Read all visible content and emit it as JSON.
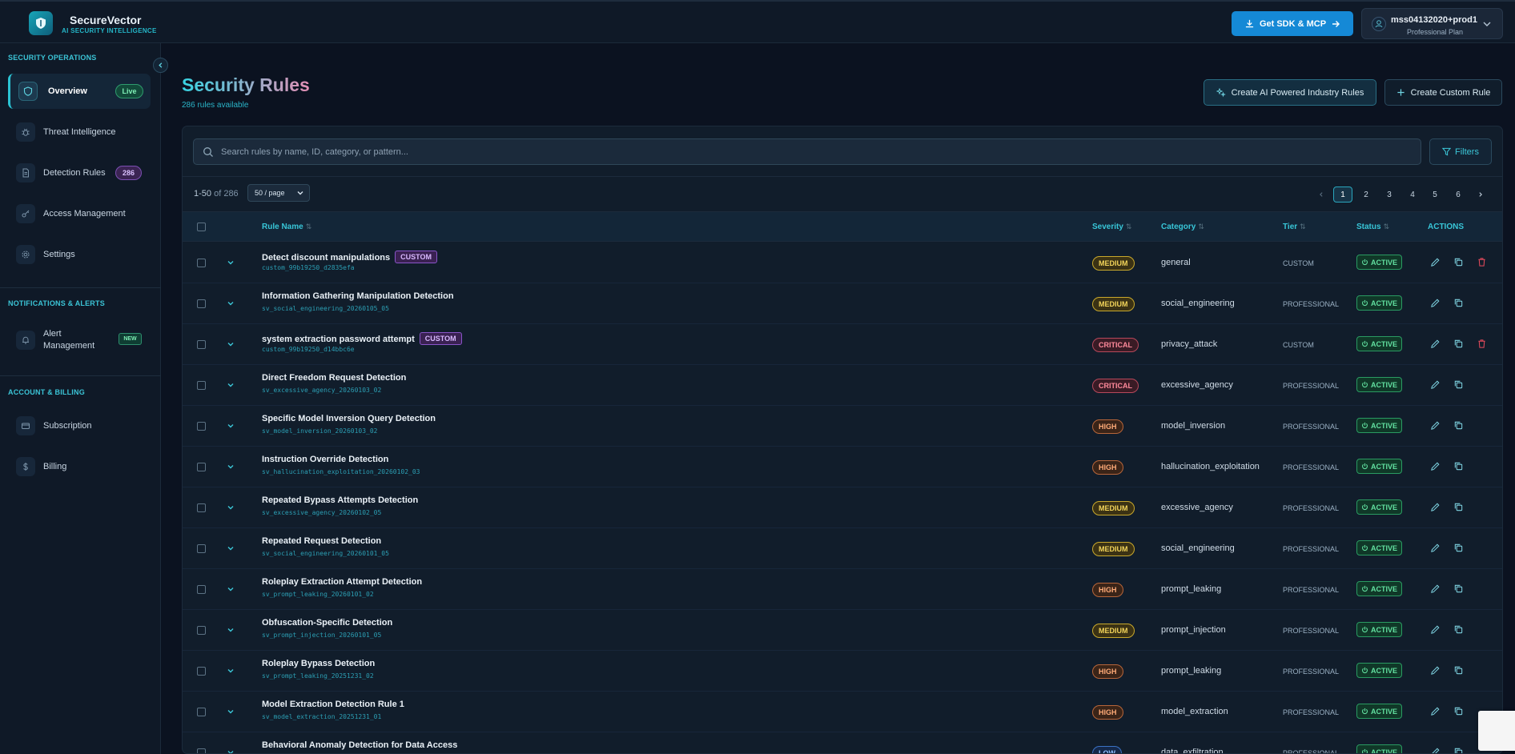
{
  "app": {
    "name": "SecureVector",
    "tagline": "AI SECURITY INTELLIGENCE"
  },
  "header": {
    "sdk_button": "Get SDK & MCP",
    "account": {
      "user": "mss04132020+prod1",
      "plan": "Professional Plan"
    }
  },
  "sidebar": {
    "sections": [
      {
        "title": "SECURITY OPERATIONS"
      },
      {
        "title": "NOTIFICATIONS & ALERTS"
      },
      {
        "title": "ACCOUNT & BILLING"
      }
    ],
    "items": [
      {
        "label": "Overview",
        "badge": "Live",
        "icon": "shield-icon"
      },
      {
        "label": "Threat Intelligence",
        "icon": "bug-icon"
      },
      {
        "label": "Detection Rules",
        "badge": "286",
        "icon": "document-icon"
      },
      {
        "label": "Access Management",
        "icon": "key-icon"
      },
      {
        "label": "Settings",
        "icon": "gear-icon"
      },
      {
        "label_line1": "Alert",
        "label_line2": "Management",
        "badge": "NEW",
        "icon": "bell-icon"
      },
      {
        "label": "Subscription",
        "icon": "card-icon"
      },
      {
        "label": "Billing",
        "icon": "dollar-icon"
      }
    ]
  },
  "page": {
    "title": "Security Rules",
    "subtitle": "286 rules available",
    "ai_button": "Create AI Powered Industry Rules",
    "custom_button": "Create Custom Rule"
  },
  "search": {
    "placeholder": "Search rules by name, ID, category, or pattern...",
    "value": ""
  },
  "filters_label": "Filters",
  "pagination": {
    "range": "1-50",
    "of": "of 286",
    "per_page": "50 / page",
    "pages": [
      "1",
      "2",
      "3",
      "4",
      "5",
      "6"
    ],
    "current": "1"
  },
  "table": {
    "columns": {
      "name": "Rule Name",
      "severity": "Severity",
      "category": "Category",
      "tier": "Tier",
      "status": "Status",
      "actions": "ACTIONS"
    },
    "rows": [
      {
        "name": "Detect discount manipulations",
        "custom": "CUSTOM",
        "id": "custom_99b19250_d2835efa",
        "severity": "MEDIUM",
        "category": "general",
        "tier": "CUSTOM",
        "status": "ACTIVE",
        "deletable": true
      },
      {
        "name": "Information Gathering Manipulation Detection",
        "id": "sv_social_engineering_20260105_05",
        "severity": "MEDIUM",
        "category": "social_engineering",
        "tier": "PROFESSIONAL",
        "status": "ACTIVE"
      },
      {
        "name": "system extraction password attempt",
        "custom": "CUSTOM",
        "id": "custom_99b19250_d14bbc6e",
        "severity": "CRITICAL",
        "category": "privacy_attack",
        "tier": "CUSTOM",
        "status": "ACTIVE",
        "deletable": true
      },
      {
        "name": "Direct Freedom Request Detection",
        "id": "sv_excessive_agency_20260103_02",
        "severity": "CRITICAL",
        "category": "excessive_agency",
        "tier": "PROFESSIONAL",
        "status": "ACTIVE"
      },
      {
        "name": "Specific Model Inversion Query Detection",
        "id": "sv_model_inversion_20260103_02",
        "severity": "HIGH",
        "category": "model_inversion",
        "tier": "PROFESSIONAL",
        "status": "ACTIVE"
      },
      {
        "name": "Instruction Override Detection",
        "id": "sv_hallucination_exploitation_20260102_03",
        "severity": "HIGH",
        "category": "hallucination_exploitation",
        "tier": "PROFESSIONAL",
        "status": "ACTIVE"
      },
      {
        "name": "Repeated Bypass Attempts Detection",
        "id": "sv_excessive_agency_20260102_05",
        "severity": "MEDIUM",
        "category": "excessive_agency",
        "tier": "PROFESSIONAL",
        "status": "ACTIVE"
      },
      {
        "name": "Repeated Request Detection",
        "id": "sv_social_engineering_20260101_05",
        "severity": "MEDIUM",
        "category": "social_engineering",
        "tier": "PROFESSIONAL",
        "status": "ACTIVE"
      },
      {
        "name": "Roleplay Extraction Attempt Detection",
        "id": "sv_prompt_leaking_20260101_02",
        "severity": "HIGH",
        "category": "prompt_leaking",
        "tier": "PROFESSIONAL",
        "status": "ACTIVE"
      },
      {
        "name": "Obfuscation-Specific Detection",
        "id": "sv_prompt_injection_20260101_05",
        "severity": "MEDIUM",
        "category": "prompt_injection",
        "tier": "PROFESSIONAL",
        "status": "ACTIVE"
      },
      {
        "name": "Roleplay Bypass Detection",
        "id": "sv_prompt_leaking_20251231_02",
        "severity": "HIGH",
        "category": "prompt_leaking",
        "tier": "PROFESSIONAL",
        "status": "ACTIVE"
      },
      {
        "name": "Model Extraction Detection Rule 1",
        "id": "sv_model_extraction_20251231_01",
        "severity": "HIGH",
        "category": "model_extraction",
        "tier": "PROFESSIONAL",
        "status": "ACTIVE"
      },
      {
        "name": "Behavioral Anomaly Detection for Data Access",
        "id": "",
        "severity": "LOW",
        "category": "data_exfiltration",
        "tier": "PROFESSIONAL",
        "status": "ACTIVE"
      }
    ]
  },
  "colors": {
    "accent": "#2bc3d3",
    "primary_button": "#1589d6",
    "medium": "#e8c53a",
    "critical": "#ef5b6e",
    "high": "#f08a4b",
    "low": "#58a6ff",
    "active": "#62e0a0",
    "custom": "#8a55c9"
  }
}
